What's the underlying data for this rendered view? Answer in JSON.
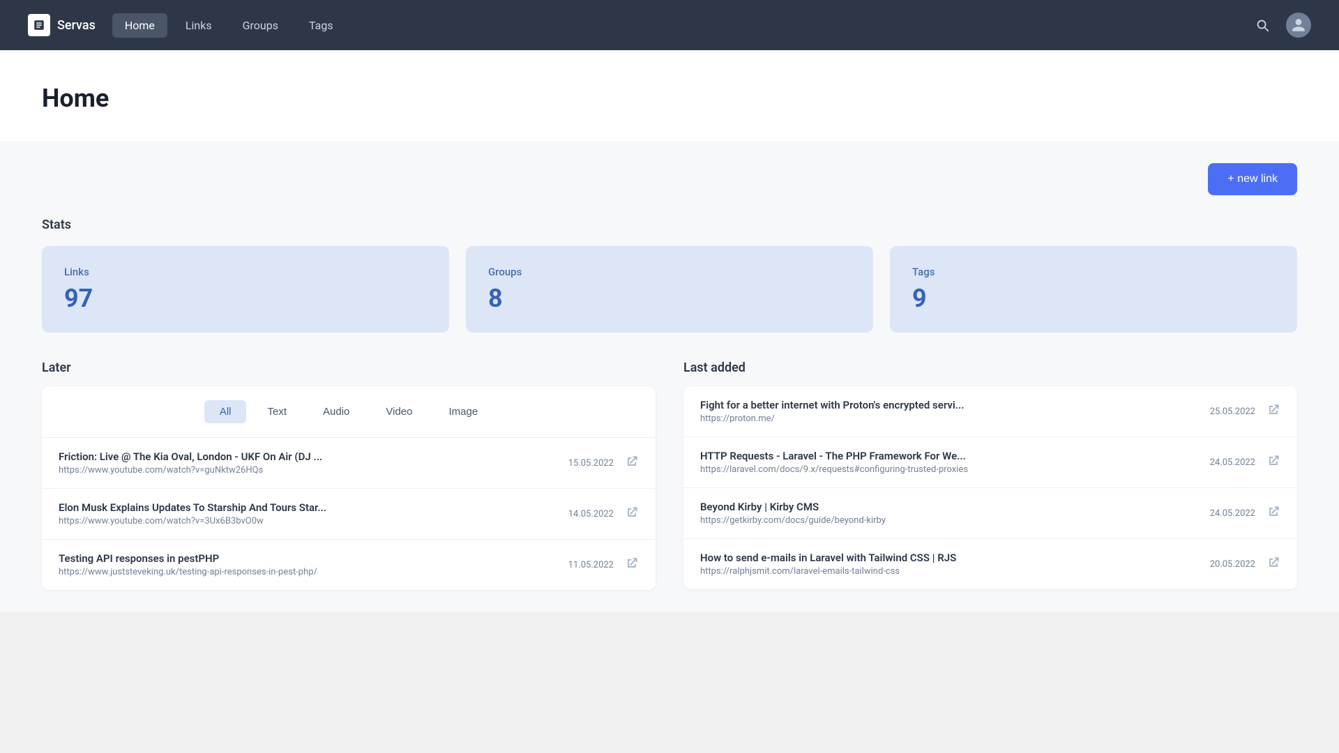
{
  "app": {
    "name": "Servas"
  },
  "nav": {
    "links": [
      "Home",
      "Links",
      "Groups",
      "Tags"
    ],
    "active": "Home"
  },
  "page": {
    "title": "Home"
  },
  "toolbar": {
    "new_link_label": "+ new link"
  },
  "stats": {
    "section_title": "Stats",
    "cards": [
      {
        "label": "Links",
        "value": "97"
      },
      {
        "label": "Groups",
        "value": "8"
      },
      {
        "label": "Tags",
        "value": "9"
      }
    ]
  },
  "later": {
    "section_title": "Later",
    "filter_tabs": [
      "All",
      "Text",
      "Audio",
      "Video",
      "Image"
    ],
    "active_tab": "All",
    "items": [
      {
        "title": "Friction: Live @ The Kia Oval, London - UKF On Air (DJ ...",
        "url": "https://www.youtube.com/watch?v=guNktw26HQs",
        "date": "15.05.2022"
      },
      {
        "title": "Elon Musk Explains Updates To Starship And Tours Star...",
        "url": "https://www.youtube.com/watch?v=3Ux6B3bvO0w",
        "date": "14.05.2022"
      },
      {
        "title": "Testing API responses in pestPHP",
        "url": "https://www.juststeveking.uk/testing-api-responses-in-pest-php/",
        "date": "11.05.2022"
      }
    ]
  },
  "last_added": {
    "section_title": "Last added",
    "items": [
      {
        "title": "Fight for a better internet with Proton's encrypted servi...",
        "url": "https://proton.me/",
        "date": "25.05.2022"
      },
      {
        "title": "HTTP Requests - Laravel - The PHP Framework For We...",
        "url": "https://laravel.com/docs/9.x/requests#configuring-trusted-proxies",
        "date": "24.05.2022"
      },
      {
        "title": "Beyond Kirby | Kirby CMS",
        "url": "https://getkirby.com/docs/guide/beyond-kirby",
        "date": "24.05.2022"
      },
      {
        "title": "How to send e-mails in Laravel with Tailwind CSS | RJS",
        "url": "https://ralphjsmit.com/laravel-emails-tailwind-css",
        "date": "20.05.2022"
      }
    ]
  }
}
